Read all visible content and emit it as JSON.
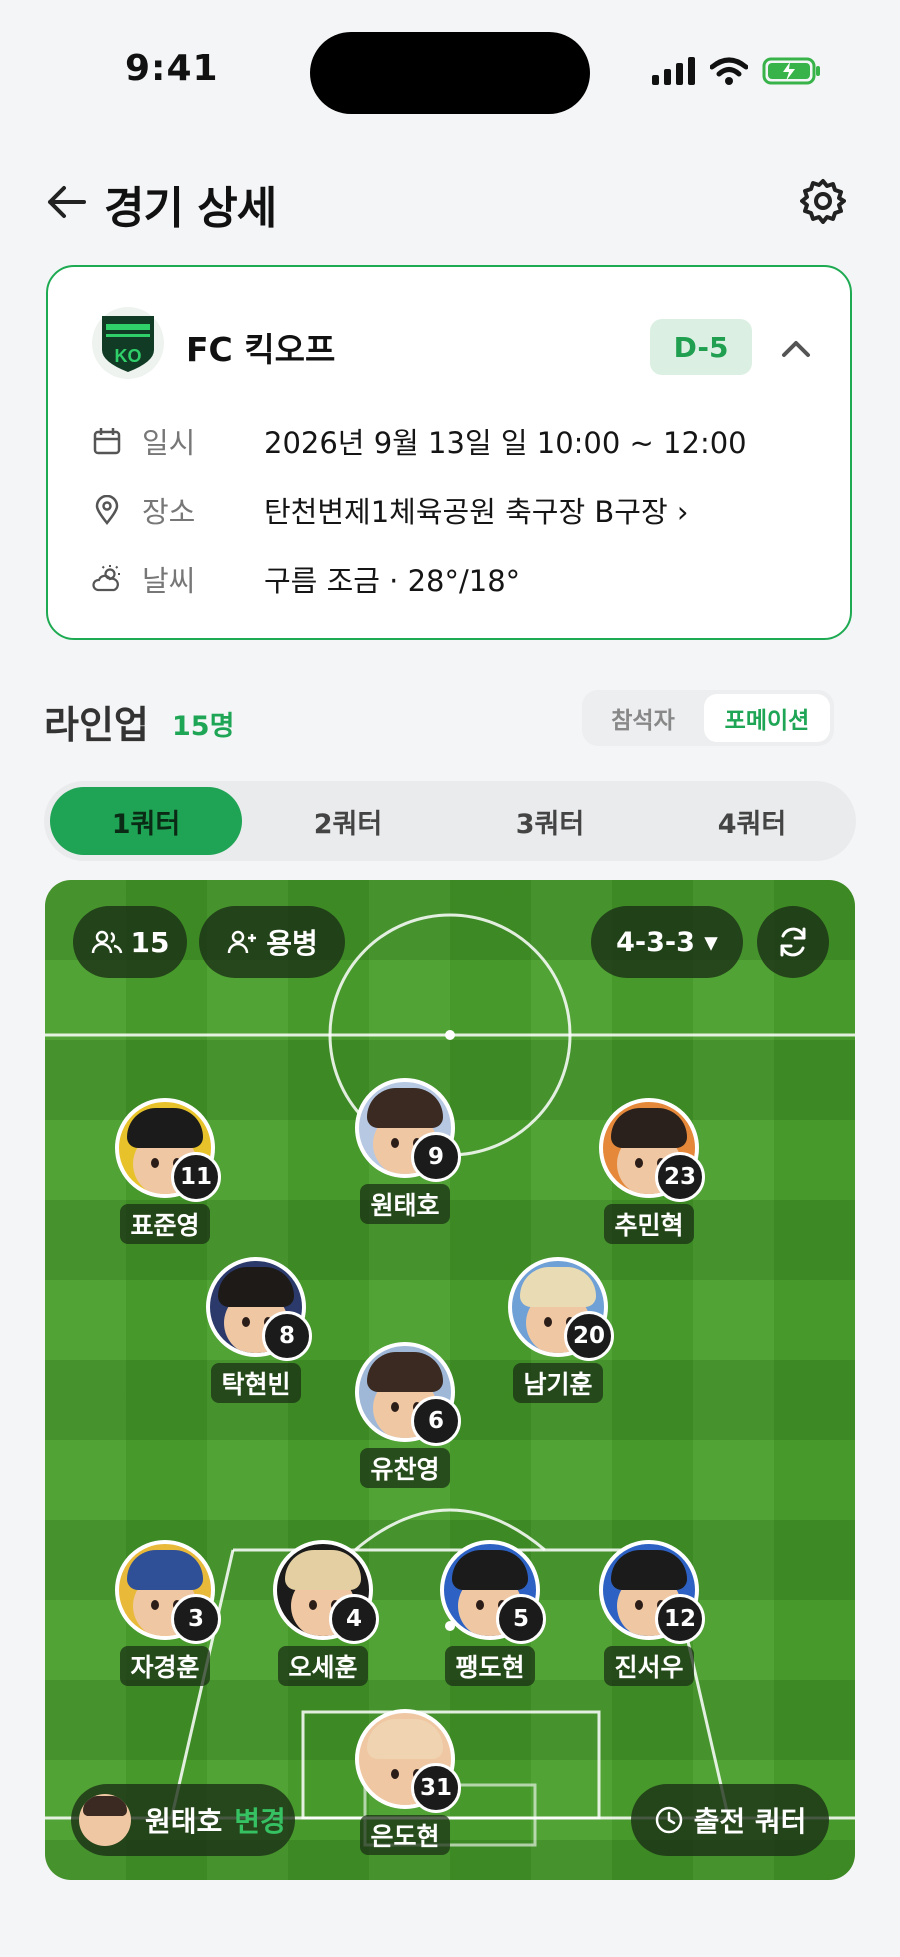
{
  "status": {
    "time": "9:41"
  },
  "header": {
    "title": "경기 상세"
  },
  "match": {
    "team_logo_text": "KO",
    "team_name": "FC 킥오프",
    "dday": "D-5",
    "rows": [
      {
        "icon": "calendar-icon",
        "label": "일시",
        "value": "2026년 9월 13일 일 10:00 ~ 12:00"
      },
      {
        "icon": "location-pin-icon",
        "label": "장소",
        "value": "탄천변제1체육공원 축구장 B구장 ›"
      },
      {
        "icon": "weather-icon",
        "label": "날씨",
        "value": "구름 조금  ·  28°/18°"
      }
    ]
  },
  "lineup": {
    "title": "라인업",
    "count": "15명",
    "view_tabs": [
      "참석자",
      "포메이션"
    ],
    "selected_view": "포메이션",
    "quarters": [
      "1쿼터",
      "2쿼터",
      "3쿼터",
      "4쿼터"
    ],
    "selected_quarter": "1쿼터"
  },
  "pitch": {
    "attendees_count": "15",
    "guest_label": "용병",
    "formation": "4-3-3 ▾",
    "captain_name": "원태호",
    "change_label": "변경",
    "play_quarter_label": "출전 쿼터",
    "players": [
      {
        "name": "표준영",
        "number": "11",
        "hair": "#1b1b1b",
        "shirt": "#e8c22a"
      },
      {
        "name": "원태호",
        "number": "9",
        "hair": "#3a2a22",
        "shirt": "#b7c8e3"
      },
      {
        "name": "추민혁",
        "number": "23",
        "hair": "#2a211d",
        "shirt": "#e5883a"
      },
      {
        "name": "탁현빈",
        "number": "8",
        "hair": "#1e1a18",
        "shirt": "#2b3a6a"
      },
      {
        "name": "남기훈",
        "number": "20",
        "hair": "#e9dcb4",
        "shirt": "#6fa0d6"
      },
      {
        "name": "유찬영",
        "number": "6",
        "hair": "#3a2a22",
        "shirt": "#9fb8d8"
      },
      {
        "name": "자경훈",
        "number": "3",
        "hair": "#2f4f96",
        "shirt": "#e9b93a"
      },
      {
        "name": "오세훈",
        "number": "4",
        "hair": "#e3cfa1",
        "shirt": "#1b1b1b"
      },
      {
        "name": "팽도현",
        "number": "5",
        "hair": "#1b1b1b",
        "shirt": "#2d62c4"
      },
      {
        "name": "진서우",
        "number": "12",
        "hair": "#1b1b1b",
        "shirt": "#2d62c4"
      },
      {
        "name": "은도현",
        "number": "31",
        "hair": "#f0d4b2",
        "shirt": "#efc7a3"
      }
    ]
  },
  "colors": {
    "accent": "#1ea454",
    "card_border": "#1eaa52"
  }
}
